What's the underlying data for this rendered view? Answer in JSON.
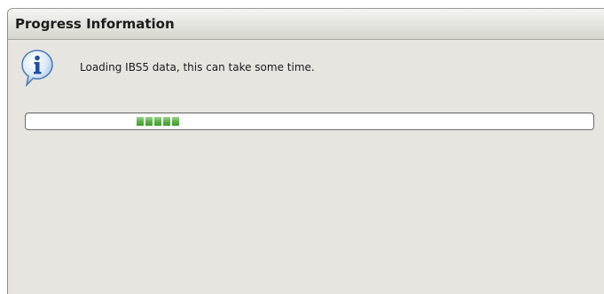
{
  "window": {
    "title": "Progress Information"
  },
  "dialog": {
    "icon": "info-icon",
    "message": "Loading IBS5 data, this can take some time."
  },
  "progress": {
    "mode": "indeterminate",
    "blocks": 5,
    "color": "#5fb14a"
  }
}
